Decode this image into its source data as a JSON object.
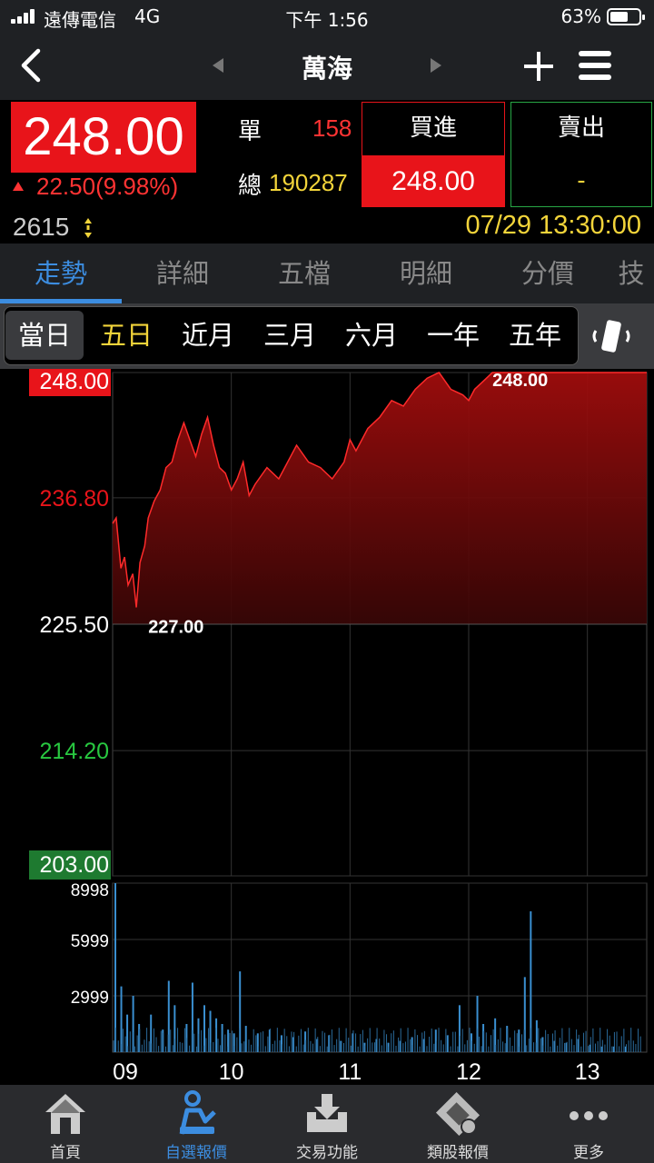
{
  "status_bar": {
    "carrier": "遠傳電信",
    "network": "4G",
    "time": "下午 1:56",
    "battery": "63%",
    "battery_level": 0.63
  },
  "nav": {
    "title": "萬海",
    "back_icon": "back-chevron-icon",
    "prev_icon": "prev-triangle-icon",
    "next_icon": "next-triangle-icon",
    "add_icon": "plus-icon",
    "menu_icon": "hamburger-menu-icon"
  },
  "quote": {
    "price": "248.00",
    "change": "22.50(9.98%)",
    "single_label": "單",
    "single_value": "158",
    "total_label": "總",
    "total_value": "190287",
    "buy_label": "買進",
    "buy_price": "248.00",
    "sell_label": "賣出",
    "sell_price": "-",
    "code": "2615",
    "datetime": "07/29 13:30:00"
  },
  "tabs": [
    {
      "label": "走勢",
      "active": true
    },
    {
      "label": "詳細",
      "active": false
    },
    {
      "label": "五檔",
      "active": false
    },
    {
      "label": "明細",
      "active": false
    },
    {
      "label": "分價",
      "active": false
    },
    {
      "label": "技",
      "active": false
    }
  ],
  "periods": [
    {
      "label": "當日",
      "state": "selected"
    },
    {
      "label": "五日",
      "state": "highlight"
    },
    {
      "label": "近月",
      "state": "normal"
    },
    {
      "label": "三月",
      "state": "normal"
    },
    {
      "label": "六月",
      "state": "normal"
    },
    {
      "label": "一年",
      "state": "normal"
    },
    {
      "label": "五年",
      "state": "normal"
    }
  ],
  "chart_data": {
    "type": "area",
    "y_ticks": [
      {
        "label": "248.00",
        "value": 248.0,
        "style": "limit-up"
      },
      {
        "label": "236.80",
        "value": 236.8,
        "style": "up"
      },
      {
        "label": "225.50",
        "value": 225.5,
        "style": "ref"
      },
      {
        "label": "214.20",
        "value": 214.2,
        "style": "down"
      },
      {
        "label": "203.00",
        "value": 203.0,
        "style": "limit-down"
      }
    ],
    "ylim": [
      203.0,
      248.0
    ],
    "reference": 225.5,
    "x_ticks": [
      "09",
      "10",
      "11",
      "12",
      "13"
    ],
    "x_tick_hours": [
      9,
      10,
      11,
      12,
      13
    ],
    "xlim": [
      9.0,
      13.5
    ],
    "annotations": [
      {
        "label": "227.00",
        "x": 9.3,
        "y": 227.0
      },
      {
        "label": "248.00",
        "x": 12.2,
        "y": 248.0
      }
    ],
    "series": [
      {
        "x": [
          9.0,
          9.03,
          9.07,
          9.1,
          9.13,
          9.17,
          9.2,
          9.23,
          9.27,
          9.3,
          9.35,
          9.4,
          9.45,
          9.5,
          9.55,
          9.6,
          9.65,
          9.7,
          9.75,
          9.8,
          9.85,
          9.9,
          9.95,
          10.0,
          10.05,
          10.1,
          10.15,
          10.2,
          10.3,
          10.4,
          10.5,
          10.55,
          10.65,
          10.75,
          10.85,
          10.95,
          11.0,
          11.05,
          11.15,
          11.25,
          11.35,
          11.45,
          11.55,
          11.65,
          11.75,
          11.85,
          11.95,
          12.0,
          12.05,
          12.1,
          12.15,
          12.2,
          12.3,
          12.4,
          12.5,
          12.6,
          12.7,
          12.8,
          12.9,
          13.0,
          13.1,
          13.2,
          13.3,
          13.4,
          13.5
        ],
        "y": [
          234.5,
          235.0,
          230.5,
          231.5,
          229.0,
          230.0,
          227.0,
          231.0,
          232.5,
          235.0,
          236.5,
          237.5,
          239.5,
          240.0,
          242.0,
          243.5,
          242.0,
          240.5,
          242.5,
          244.0,
          241.5,
          239.5,
          239.0,
          237.5,
          238.5,
          240.0,
          237.0,
          238.0,
          239.5,
          238.5,
          240.5,
          241.5,
          240.0,
          239.5,
          238.5,
          240.0,
          242.0,
          241.0,
          243.0,
          244.0,
          245.5,
          245.0,
          246.5,
          247.5,
          248.0,
          246.5,
          246.0,
          245.5,
          246.5,
          247.0,
          247.5,
          248.0,
          248.0,
          248.0,
          248.0,
          248.0,
          248.0,
          248.0,
          248.0,
          248.0,
          248.0,
          248.0,
          248.0,
          248.0,
          248.0
        ]
      }
    ]
  },
  "volume_data": {
    "type": "bar",
    "y_ticks": [
      {
        "label": "8998",
        "value": 8998
      },
      {
        "label": "5999",
        "value": 5999
      },
      {
        "label": "2999",
        "value": 2999
      }
    ],
    "ylim": [
      0,
      8998
    ],
    "x": [
      9.0,
      9.05,
      9.1,
      9.15,
      9.2,
      9.3,
      9.4,
      9.45,
      9.5,
      9.6,
      9.65,
      9.7,
      9.75,
      9.8,
      9.85,
      9.9,
      9.95,
      10.0,
      10.05,
      10.1,
      10.2,
      10.3,
      10.4,
      10.5,
      10.6,
      10.7,
      10.8,
      10.9,
      11.0,
      11.1,
      11.2,
      11.3,
      11.4,
      11.5,
      11.6,
      11.7,
      11.8,
      11.9,
      12.0,
      12.05,
      12.1,
      12.2,
      12.3,
      12.4,
      12.45,
      12.5,
      12.55,
      12.6,
      12.7,
      12.8,
      12.9,
      13.0,
      13.1,
      13.2,
      13.3
    ],
    "values": [
      8998,
      3500,
      2000,
      3000,
      1500,
      2000,
      1200,
      3800,
      2500,
      1500,
      3700,
      1800,
      2500,
      2200,
      1800,
      1500,
      1200,
      1000,
      4300,
      1400,
      1000,
      1200,
      900,
      800,
      1100,
      700,
      900,
      600,
      1000,
      500,
      700,
      500,
      600,
      800,
      700,
      1200,
      900,
      2500,
      1000,
      3000,
      1500,
      1800,
      1400,
      1200,
      4000,
      7500,
      1700,
      800,
      600,
      500,
      700,
      400,
      300,
      300,
      300
    ]
  },
  "bottom_nav": [
    {
      "label": "首頁",
      "icon": "home-icon",
      "active": false
    },
    {
      "label": "自選報價",
      "icon": "custom-quote-icon",
      "active": true
    },
    {
      "label": "交易功能",
      "icon": "trade-download-icon",
      "active": false
    },
    {
      "label": "類股報價",
      "icon": "sector-film-icon",
      "active": false
    },
    {
      "label": "更多",
      "icon": "more-dots-icon",
      "active": false
    }
  ],
  "colors": {
    "up": "#e8141a",
    "down": "#28c840",
    "accent": "#3c8de0",
    "yellow": "#f2d43a"
  }
}
